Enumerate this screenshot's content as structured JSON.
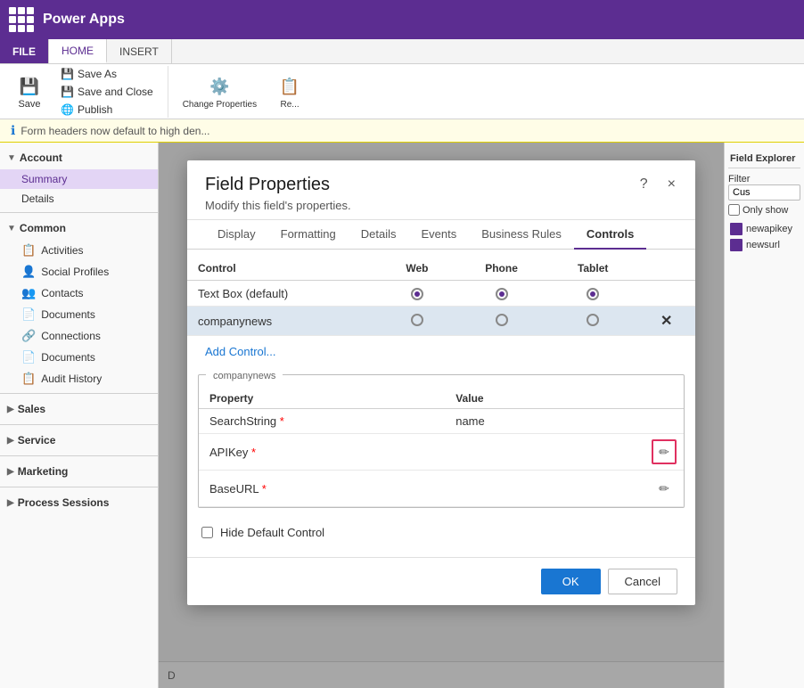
{
  "topbar": {
    "app_name": "Power Apps",
    "grid_icon": "apps-icon"
  },
  "ribbon": {
    "tabs": [
      {
        "label": "FILE",
        "id": "file",
        "is_file": true
      },
      {
        "label": "HOME",
        "id": "home",
        "active": true
      },
      {
        "label": "INSERT",
        "id": "insert"
      }
    ],
    "save_label": "Save",
    "save_as_label": "Save As",
    "save_close_label": "Save and Close",
    "publish_label": "Publish",
    "change_properties_label": "Change\nProperties",
    "group_save_label": "Save"
  },
  "notification": {
    "text": "Form headers now default to high den..."
  },
  "sidebar": {
    "sections": [
      {
        "label": "Account",
        "items": [
          {
            "label": "Summary",
            "active": true
          },
          {
            "label": "Details"
          }
        ]
      },
      {
        "label": "Common",
        "items": [
          {
            "label": "Activities",
            "icon": "📋"
          },
          {
            "label": "Social Profiles",
            "icon": "👤"
          },
          {
            "label": "Contacts",
            "icon": "👥"
          },
          {
            "label": "Documents",
            "icon": "📄"
          },
          {
            "label": "Connections",
            "icon": "🔗"
          },
          {
            "label": "Documents",
            "icon": "📄"
          },
          {
            "label": "Audit History",
            "icon": "📋"
          }
        ]
      },
      {
        "label": "Sales",
        "items": []
      },
      {
        "label": "Service",
        "items": []
      },
      {
        "label": "Marketing",
        "items": []
      },
      {
        "label": "Process Sessions",
        "items": []
      }
    ]
  },
  "right_panel": {
    "title": "Field Explorer",
    "filter_label": "Filter",
    "filter_placeholder": "Cus",
    "only_show_label": "Only show",
    "items": [
      {
        "label": "newapikey"
      },
      {
        "label": "newsurl"
      }
    ]
  },
  "modal": {
    "title": "Field Properties",
    "subtitle": "Modify this field's properties.",
    "help_btn": "?",
    "close_btn": "×",
    "tabs": [
      {
        "label": "Display"
      },
      {
        "label": "Formatting"
      },
      {
        "label": "Details"
      },
      {
        "label": "Events"
      },
      {
        "label": "Business Rules"
      },
      {
        "label": "Controls",
        "active": true
      }
    ],
    "controls_table": {
      "headers": [
        "Control",
        "Web",
        "Phone",
        "Tablet"
      ],
      "rows": [
        {
          "name": "Text Box (default)",
          "web_checked": true,
          "phone_checked": true,
          "tablet_checked": true,
          "selected": false,
          "has_delete": false
        },
        {
          "name": "companynews",
          "web_checked": false,
          "phone_checked": false,
          "tablet_checked": false,
          "selected": true,
          "has_delete": true
        }
      ]
    },
    "add_control_label": "Add Control...",
    "properties_section_label": "companynews",
    "properties_table": {
      "headers": [
        "Property",
        "Value"
      ],
      "rows": [
        {
          "property": "SearchString",
          "required": true,
          "value": "name",
          "has_edit": false,
          "edit_highlighted": false
        },
        {
          "property": "APIKey",
          "required": true,
          "value": "",
          "has_edit": true,
          "edit_highlighted": true
        },
        {
          "property": "BaseURL",
          "required": true,
          "value": "",
          "has_edit": true,
          "edit_highlighted": false
        }
      ]
    },
    "hide_default_label": "Hide Default Control",
    "hide_default_checked": false,
    "ok_label": "OK",
    "cancel_label": "Cancel"
  }
}
